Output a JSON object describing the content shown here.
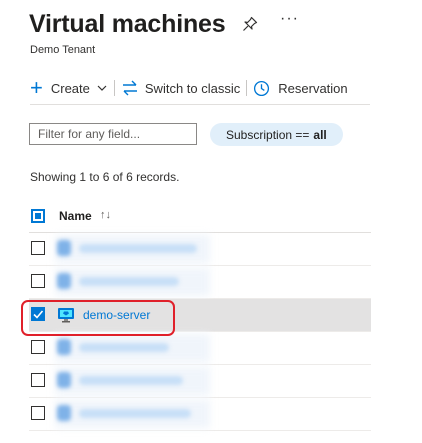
{
  "header": {
    "title": "Virtual machines",
    "subtitle": "Demo Tenant",
    "more_label": "···"
  },
  "toolbar": {
    "create_label": "Create",
    "switch_label": "Switch to classic",
    "reservation_label": "Reservation"
  },
  "filter": {
    "placeholder": "Filter for any field...",
    "subscription_prefix": "Subscription ==",
    "subscription_value": "all"
  },
  "records_text": "Showing 1 to 6 of 6 records.",
  "table": {
    "columns": [
      "Name"
    ],
    "sort_glyph": "↑↓",
    "rows": [
      {
        "name": "",
        "selected": false,
        "redacted": true
      },
      {
        "name": "",
        "selected": false,
        "redacted": true
      },
      {
        "name": "demo-server",
        "selected": true,
        "redacted": false
      },
      {
        "name": "",
        "selected": false,
        "redacted": true
      },
      {
        "name": "",
        "selected": false,
        "redacted": true
      },
      {
        "name": "",
        "selected": false,
        "redacted": true
      }
    ]
  },
  "colors": {
    "accent": "#0078d4",
    "highlight": "#e0202a",
    "selected_row": "#e3e2e2"
  }
}
